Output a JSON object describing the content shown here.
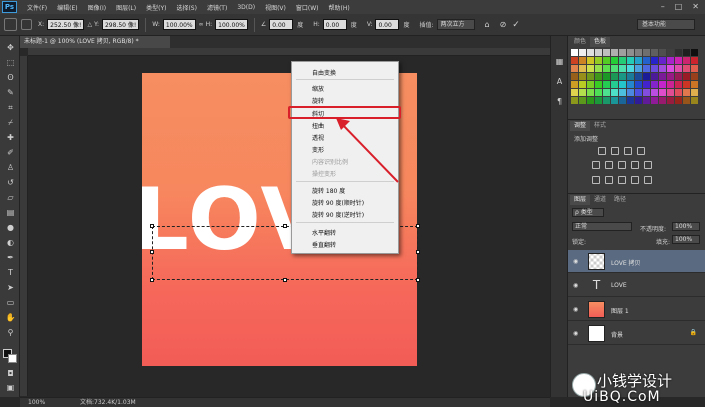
{
  "app": {
    "logo": "Ps"
  },
  "menu": [
    "文件(F)",
    "编辑(E)",
    "图像(I)",
    "图层(L)",
    "类型(Y)",
    "选择(S)",
    "滤镜(T)",
    "3D(D)",
    "视图(V)",
    "窗口(W)",
    "帮助(H)"
  ],
  "window_controls": {
    "min": "–",
    "max": "□",
    "close": "✕"
  },
  "options": {
    "x_label": "X:",
    "x_value": "252.50 像!",
    "y_label": "Y:",
    "y_value": "298.50 像!",
    "w_label": "W:",
    "w_value": "100.00%",
    "h_label": "H:",
    "h_value": "100.00%",
    "angle_value": "0.00",
    "angle_unit": "度",
    "hskew_label": "H:",
    "hskew_value": "0.00",
    "hskew_unit": "度",
    "vskew_label": "V:",
    "vskew_value": "0.00",
    "vskew_unit": "度",
    "interp_label": "插值:",
    "interp_value": "两次立方",
    "workspace": "基本功能"
  },
  "document": {
    "tab_title": "未标题-1 @ 100% (LOVE 拷贝, RGB/8) *",
    "canvas_text": "LOVE"
  },
  "context_menu": {
    "items": [
      {
        "label": "自由变换",
        "disabled": false
      },
      {
        "label": "缩放",
        "disabled": false
      },
      {
        "label": "旋转",
        "disabled": false
      },
      {
        "label": "斜切",
        "disabled": false,
        "highlighted": true
      },
      {
        "label": "扭曲",
        "disabled": false
      },
      {
        "label": "透视",
        "disabled": false
      },
      {
        "label": "变形",
        "disabled": false
      },
      {
        "label": "内容识别比例",
        "disabled": true
      },
      {
        "label": "操控变形",
        "disabled": true
      },
      {
        "label": "旋转 180 度",
        "disabled": false
      },
      {
        "label": "旋转 90 度(顺时针)",
        "disabled": false
      },
      {
        "label": "旋转 90 度(逆时针)",
        "disabled": false
      },
      {
        "label": "水平翻转",
        "disabled": false
      },
      {
        "label": "垂直翻转",
        "disabled": false
      }
    ]
  },
  "panels": {
    "color_tabs": [
      "颜色",
      "色板"
    ],
    "adjust_tabs": [
      "调整",
      "样式"
    ],
    "adjust_hint": "添加调整",
    "layer_tabs": [
      "图层",
      "通道",
      "路径"
    ],
    "kind_filter": "ρ 类型",
    "blend_mode": "正常",
    "opacity_label": "不透明度:",
    "opacity_value": "100%",
    "lock_label": "锁定:",
    "fill_label": "填充:",
    "fill_value": "100%",
    "layers": [
      {
        "name": "LOVE 拷贝",
        "selected": true,
        "kind": "smart"
      },
      {
        "name": "LOVE",
        "selected": false,
        "kind": "text"
      },
      {
        "name": "图层 1",
        "selected": false,
        "kind": "gradient"
      },
      {
        "name": "背景",
        "selected": false,
        "kind": "background",
        "locked": true
      }
    ],
    "text_layer_glyph": "T",
    "eye_glyph": "◉",
    "lock_glyph": "🔒"
  },
  "status": {
    "zoom": "100%",
    "doc_info": "文档:732.4K/1.03M"
  },
  "watermark": {
    "brand": "小钱学设计",
    "site": "UiBQ.CoM"
  },
  "colors": {
    "accent_highlight": "#d81f2a",
    "canvas_top": "#f68e61",
    "canvas_bottom": "#f25d56",
    "selected_layer": "#5a6a80"
  }
}
